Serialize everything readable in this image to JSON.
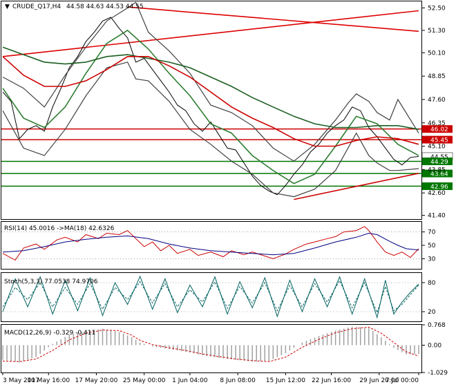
{
  "chart_data": [
    {
      "type": "line",
      "title": "CRUDE_Q17,H4",
      "ohlc_readout": "44.58 44.63 44.53 44.55",
      "yticks": [
        "52.50",
        "51.30",
        "50.10",
        "48.85",
        "47.60",
        "46.35",
        "45.10",
        "43.85",
        "42.60",
        "41.40"
      ],
      "ytick_values": [
        52.5,
        51.3,
        50.1,
        48.85,
        47.6,
        46.35,
        45.1,
        43.85,
        42.6,
        41.4
      ],
      "ylim": [
        41.2,
        52.85
      ],
      "xlim": [
        0,
        100
      ],
      "colors": {
        "price": "#000000",
        "bands": "#404040",
        "ma_fast": "#2e7d32",
        "ma_slow": "#1b5e20",
        "ma_red": "#cc0000",
        "levels": "#cc0000",
        "support": "#007700",
        "current": "#ffffff"
      },
      "level_lines": [
        {
          "value": 46.02,
          "label": "46.02",
          "color": "#cc0000"
        },
        {
          "value": 45.45,
          "label": "45.45",
          "color": "#cc0000"
        },
        {
          "value": 44.55,
          "label": "44.55",
          "color": "#ffffff"
        },
        {
          "value": 44.29,
          "label": "44.29",
          "color": "#007700"
        },
        {
          "value": 43.64,
          "label": "43.64",
          "color": "#007700"
        },
        {
          "value": 42.96,
          "label": "42.96",
          "color": "#007700"
        }
      ],
      "trend_lines": [
        {
          "x": [
            0,
            100
          ],
          "y": [
            49.9,
            52.35
          ]
        },
        {
          "x": [
            30,
            100
          ],
          "y": [
            52.55,
            51.25
          ]
        },
        {
          "x": [
            70,
            100
          ],
          "y": [
            42.25,
            43.65
          ]
        }
      ],
      "series": [
        {
          "role": "price",
          "color": "#000000",
          "x": [
            0,
            2,
            4,
            6,
            8,
            10,
            12,
            14,
            16,
            18,
            20,
            22,
            24,
            26,
            28,
            30,
            32,
            34,
            36,
            38,
            40,
            42,
            44,
            46,
            48,
            50,
            52,
            54,
            56,
            58,
            60,
            62,
            64,
            66,
            68,
            70,
            72,
            74,
            76,
            78,
            80,
            82,
            84,
            86,
            88,
            90,
            92,
            94,
            96,
            98,
            100
          ],
          "y": [
            48.0,
            47.5,
            45.5,
            46.0,
            46.2,
            45.9,
            47.2,
            48.2,
            49.3,
            49.9,
            50.7,
            51.2,
            51.8,
            52.0,
            51.4,
            50.9,
            49.6,
            49.8,
            49.2,
            48.6,
            48.0,
            47.3,
            47.0,
            46.3,
            45.9,
            46.4,
            45.7,
            45.0,
            44.9,
            44.2,
            43.5,
            43.0,
            42.7,
            42.5,
            43.0,
            43.6,
            44.1,
            44.8,
            45.2,
            45.8,
            46.2,
            46.5,
            47.2,
            47.0,
            46.1,
            45.6,
            45.0,
            44.4,
            44.1,
            44.5,
            44.55
          ]
        },
        {
          "role": "upper-band",
          "color": "#404040",
          "x": [
            0,
            5,
            10,
            15,
            20,
            25,
            30,
            32,
            35,
            40,
            45,
            50,
            55,
            60,
            65,
            70,
            75,
            80,
            83,
            85,
            88,
            90,
            93,
            95,
            100
          ],
          "y": [
            48.8,
            48.2,
            47.2,
            48.9,
            50.4,
            51.8,
            52.5,
            52.8,
            51.2,
            50.2,
            49.0,
            47.3,
            46.9,
            46.2,
            45.0,
            44.3,
            45.2,
            46.5,
            47.4,
            47.9,
            47.5,
            46.9,
            46.5,
            47.6,
            45.8
          ]
        },
        {
          "role": "lower-band",
          "color": "#404040",
          "x": [
            0,
            5,
            10,
            15,
            20,
            25,
            30,
            32,
            35,
            40,
            45,
            50,
            55,
            60,
            65,
            70,
            75,
            80,
            83,
            85,
            88,
            90,
            93,
            95,
            100
          ],
          "y": [
            47.0,
            45.0,
            44.6,
            46.0,
            47.8,
            49.3,
            49.6,
            48.7,
            48.6,
            47.5,
            46.0,
            45.2,
            44.3,
            43.6,
            42.6,
            42.4,
            42.8,
            43.8,
            45.0,
            45.8,
            44.6,
            44.2,
            43.8,
            43.8,
            43.9
          ]
        },
        {
          "role": "ma-fast",
          "color": "#2e7d32",
          "x": [
            0,
            5,
            10,
            15,
            20,
            25,
            30,
            35,
            40,
            45,
            50,
            55,
            60,
            65,
            70,
            75,
            80,
            85,
            90,
            95,
            100
          ],
          "y": [
            48.2,
            46.6,
            46.1,
            47.2,
            49.0,
            50.6,
            51.3,
            50.3,
            49.0,
            47.8,
            46.3,
            45.8,
            44.6,
            43.8,
            43.1,
            43.6,
            45.1,
            46.7,
            46.3,
            45.2,
            44.6
          ]
        },
        {
          "role": "ma-slow",
          "color": "#1b5e20",
          "x": [
            0,
            5,
            10,
            15,
            20,
            25,
            30,
            35,
            40,
            45,
            50,
            55,
            60,
            65,
            70,
            75,
            80,
            85,
            90,
            95,
            100
          ],
          "y": [
            50.4,
            50.0,
            49.6,
            49.5,
            49.6,
            49.9,
            50.0,
            49.8,
            49.6,
            49.3,
            48.8,
            48.3,
            47.7,
            47.2,
            46.7,
            46.3,
            46.1,
            46.1,
            46.2,
            46.2,
            46.0
          ]
        },
        {
          "role": "ma-red",
          "color": "#cc0000",
          "x": [
            0,
            5,
            10,
            15,
            20,
            25,
            30,
            35,
            40,
            45,
            50,
            55,
            60,
            65,
            70,
            75,
            80,
            85,
            90,
            95,
            100
          ],
          "y": [
            49.9,
            48.9,
            48.3,
            48.3,
            48.6,
            49.2,
            49.9,
            49.9,
            49.4,
            48.8,
            48.0,
            47.2,
            46.6,
            46.1,
            45.5,
            45.1,
            45.1,
            45.4,
            45.6,
            45.5,
            45.2
          ]
        }
      ]
    },
    {
      "type": "line",
      "title": "RSI(14) 45.0016   ->MA(18) 42.6326",
      "yticks": [
        "70",
        "50",
        "30"
      ],
      "ytick_values": [
        70,
        50,
        30
      ],
      "ylim": [
        15,
        85
      ],
      "xlim": [
        0,
        100
      ],
      "series": [
        {
          "role": "rsi",
          "color": "#cc0000",
          "x": [
            0,
            3,
            5,
            8,
            10,
            13,
            15,
            18,
            20,
            23,
            25,
            28,
            30,
            32,
            34,
            36,
            38,
            40,
            42,
            45,
            47,
            50,
            53,
            55,
            58,
            60,
            63,
            65,
            68,
            70,
            73,
            75,
            78,
            80,
            82,
            85,
            87,
            88,
            90,
            92,
            94,
            96,
            98,
            100
          ],
          "y": [
            38,
            28,
            46,
            52,
            44,
            58,
            62,
            55,
            66,
            60,
            68,
            66,
            72,
            60,
            48,
            55,
            42,
            50,
            38,
            44,
            35,
            40,
            33,
            42,
            36,
            40,
            34,
            30,
            37,
            44,
            52,
            55,
            60,
            63,
            70,
            72,
            78,
            72,
            55,
            40,
            35,
            40,
            32,
            45
          ]
        },
        {
          "role": "rsi-ma",
          "color": "#000080",
          "x": [
            0,
            5,
            10,
            15,
            20,
            25,
            30,
            35,
            40,
            45,
            50,
            55,
            60,
            65,
            70,
            75,
            80,
            85,
            88,
            90,
            93,
            95,
            97,
            100
          ],
          "y": [
            40,
            42,
            48,
            55,
            59,
            62,
            64,
            60,
            52,
            46,
            42,
            40,
            38,
            36,
            38,
            46,
            55,
            62,
            68,
            66,
            56,
            50,
            45,
            43
          ]
        }
      ]
    },
    {
      "type": "line",
      "title": "Stoch(5,3,3) 77.0538 74.9706",
      "yticks": [
        "80",
        "20"
      ],
      "ytick_values": [
        80,
        20
      ],
      "ylim": [
        0,
        100
      ],
      "xlim": [
        0,
        100
      ],
      "series": [
        {
          "role": "main",
          "color": "#006060",
          "x": [
            0,
            3,
            6,
            9,
            12,
            15,
            18,
            21,
            24,
            27,
            30,
            33,
            36,
            39,
            42,
            45,
            48,
            51,
            54,
            57,
            60,
            63,
            66,
            69,
            72,
            75,
            78,
            81,
            84,
            87,
            90,
            92,
            94,
            96,
            98,
            100
          ],
          "y": [
            20,
            88,
            30,
            92,
            15,
            85,
            22,
            90,
            12,
            80,
            35,
            93,
            25,
            88,
            18,
            75,
            30,
            92,
            15,
            82,
            28,
            90,
            10,
            85,
            20,
            88,
            30,
            92,
            15,
            88,
            8,
            85,
            15,
            40,
            60,
            77
          ]
        },
        {
          "role": "signal",
          "color": "#006060",
          "x": [
            0,
            3,
            6,
            9,
            12,
            15,
            18,
            21,
            24,
            27,
            30,
            33,
            36,
            39,
            42,
            45,
            48,
            51,
            54,
            57,
            60,
            63,
            66,
            69,
            72,
            75,
            78,
            81,
            84,
            87,
            90,
            92,
            94,
            96,
            98,
            100
          ],
          "y": [
            30,
            70,
            45,
            80,
            30,
            70,
            35,
            78,
            25,
            70,
            45,
            82,
            38,
            78,
            30,
            65,
            40,
            82,
            27,
            72,
            38,
            80,
            22,
            74,
            30,
            78,
            40,
            84,
            28,
            80,
            18,
            72,
            22,
            35,
            55,
            75
          ]
        }
      ]
    },
    {
      "type": "bar",
      "title": "MACD(12,26,9) -0.329 -0.411",
      "yticks": [
        "0.768",
        "0.00",
        "-1.029"
      ],
      "ytick_values": [
        0.768,
        0.0,
        -1.029
      ],
      "ylim": [
        -1.029,
        0.768
      ],
      "xlim": [
        0,
        100
      ],
      "histogram": {
        "x": [
          0,
          4,
          8,
          12,
          16,
          20,
          24,
          28,
          31,
          33,
          36,
          40,
          44,
          48,
          52,
          56,
          60,
          64,
          68,
          72,
          76,
          80,
          84,
          88,
          91,
          94,
          97,
          100
        ],
        "y": [
          -0.55,
          -0.65,
          -0.45,
          0.05,
          0.4,
          0.55,
          0.62,
          0.5,
          0.3,
          0.1,
          -0.05,
          -0.15,
          -0.25,
          -0.38,
          -0.48,
          -0.55,
          -0.62,
          -0.6,
          -0.3,
          0.1,
          0.35,
          0.55,
          0.7,
          0.65,
          0.3,
          -0.1,
          -0.35,
          -0.33
        ]
      },
      "signal": {
        "color": "#cc0000",
        "x": [
          0,
          4,
          8,
          12,
          16,
          20,
          24,
          28,
          31,
          33,
          36,
          40,
          44,
          48,
          52,
          56,
          60,
          64,
          68,
          72,
          76,
          80,
          84,
          88,
          91,
          94,
          97,
          100
        ],
        "y": [
          -0.6,
          -0.62,
          -0.52,
          -0.2,
          0.2,
          0.45,
          0.57,
          0.55,
          0.38,
          0.18,
          0.02,
          -0.1,
          -0.2,
          -0.33,
          -0.43,
          -0.52,
          -0.58,
          -0.62,
          -0.45,
          -0.08,
          0.22,
          0.47,
          0.62,
          0.68,
          0.45,
          0.1,
          -0.25,
          -0.41
        ]
      }
    }
  ],
  "x_axis_labels": [
    "3 May 2017",
    "10 May 16:00",
    "17 May 20:00",
    "25 May 00:00",
    "1 Jun 04:00",
    "8 Jun 08:00",
    "15 Jun 12:00",
    "22 Jun 16:00",
    "29 Jun 20:00",
    "7 Jul 00:00"
  ],
  "x_axis_positions": [
    0,
    11,
    22.5,
    34,
    45,
    56.5,
    68,
    79,
    90.5,
    100
  ]
}
